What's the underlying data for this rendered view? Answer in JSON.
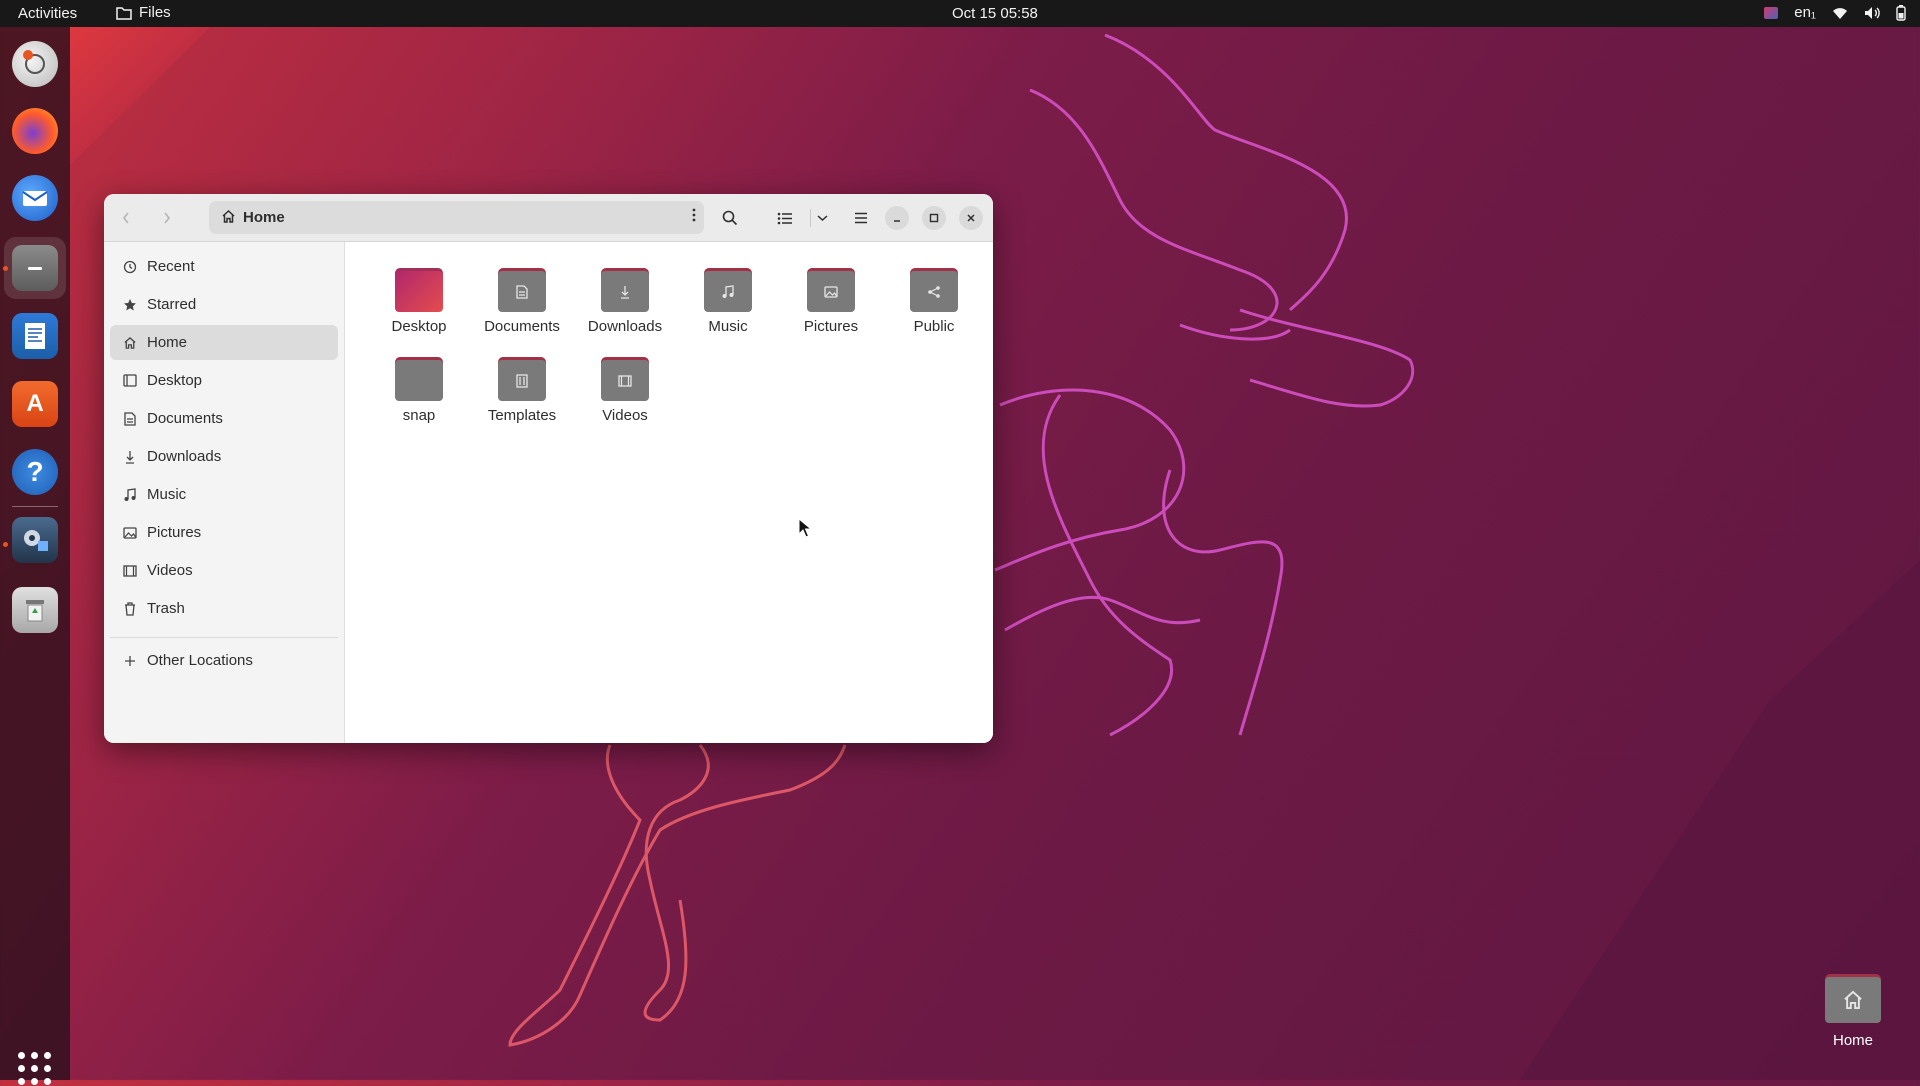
{
  "topbar": {
    "activities": "Activities",
    "app_name": "Files",
    "clock": "Oct 15  05:58",
    "keyboard_layout": "en₁"
  },
  "dock": {
    "apps": [
      "ubuntu-installer-icon",
      "firefox-icon",
      "thunderbird-icon",
      "files-icon",
      "libreoffice-writer-icon",
      "app-center-icon",
      "help-icon",
      "screenshot-app-icon",
      "trash-icon"
    ],
    "active_app": "files-icon"
  },
  "window": {
    "path": {
      "label": "Home"
    },
    "sidebar": {
      "items": [
        {
          "label": "Recent",
          "icon": "clock-icon"
        },
        {
          "label": "Starred",
          "icon": "star-icon"
        },
        {
          "label": "Home",
          "icon": "home-icon",
          "active": true
        },
        {
          "label": "Desktop",
          "icon": "desktop-icon"
        },
        {
          "label": "Documents",
          "icon": "document-icon"
        },
        {
          "label": "Downloads",
          "icon": "download-icon"
        },
        {
          "label": "Music",
          "icon": "music-icon"
        },
        {
          "label": "Pictures",
          "icon": "picture-icon"
        },
        {
          "label": "Videos",
          "icon": "video-icon"
        },
        {
          "label": "Trash",
          "icon": "trash-icon"
        }
      ],
      "other_locations": "Other Locations"
    },
    "files": [
      {
        "label": "Desktop",
        "icon": "desktop-folder-icon"
      },
      {
        "label": "Documents",
        "icon": "documents-folder-icon"
      },
      {
        "label": "Downloads",
        "icon": "downloads-folder-icon"
      },
      {
        "label": "Music",
        "icon": "music-folder-icon"
      },
      {
        "label": "Pictures",
        "icon": "pictures-folder-icon"
      },
      {
        "label": "Public",
        "icon": "public-folder-icon"
      },
      {
        "label": "snap",
        "icon": "folder-icon"
      },
      {
        "label": "Templates",
        "icon": "templates-folder-icon"
      },
      {
        "label": "Videos",
        "icon": "videos-folder-icon"
      }
    ]
  },
  "desktop": {
    "home_label": "Home"
  },
  "colors": {
    "accent": "#e95420",
    "folder_tab": "#a23148",
    "folder_body": "#7a7a7a",
    "topbar": "#181818"
  }
}
